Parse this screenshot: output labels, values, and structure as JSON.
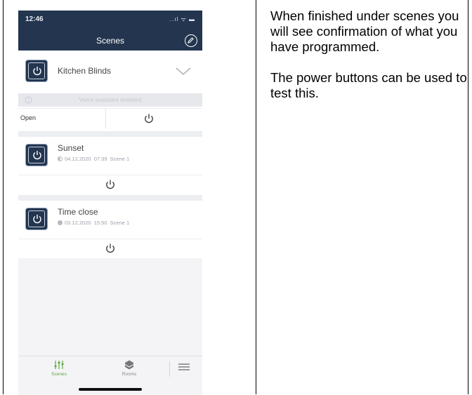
{
  "status": {
    "time": "12:46",
    "sys_icons": "..ıl ᯤ ▬"
  },
  "nav": {
    "title": "Scenes"
  },
  "device": {
    "name": "Kitchen Blinds",
    "voice_notice": "Voice assistant enabled",
    "action_label": "Open"
  },
  "scenes": [
    {
      "name": "Sunset",
      "date": "04.12.2020",
      "time": "07:39",
      "tag": "Scene 1"
    },
    {
      "name": "Time close",
      "date": "03.12.2020",
      "time": "15:50",
      "tag": "Scene 1"
    }
  ],
  "tabs": [
    {
      "label": "Scenes",
      "icon": "sliders-icon"
    },
    {
      "label": "Rooms",
      "icon": "rooms-icon"
    },
    {
      "label": "",
      "icon": "menu-icon"
    }
  ],
  "instructions": {
    "para1": "When finished under scenes you will see confirmation of what you have programmed.",
    "para2": "The power buttons can be used to test this."
  },
  "colors": {
    "nav_bg": "#23354f",
    "accent_green": "#5aa63c",
    "text_gray": "#9aa0a8"
  }
}
